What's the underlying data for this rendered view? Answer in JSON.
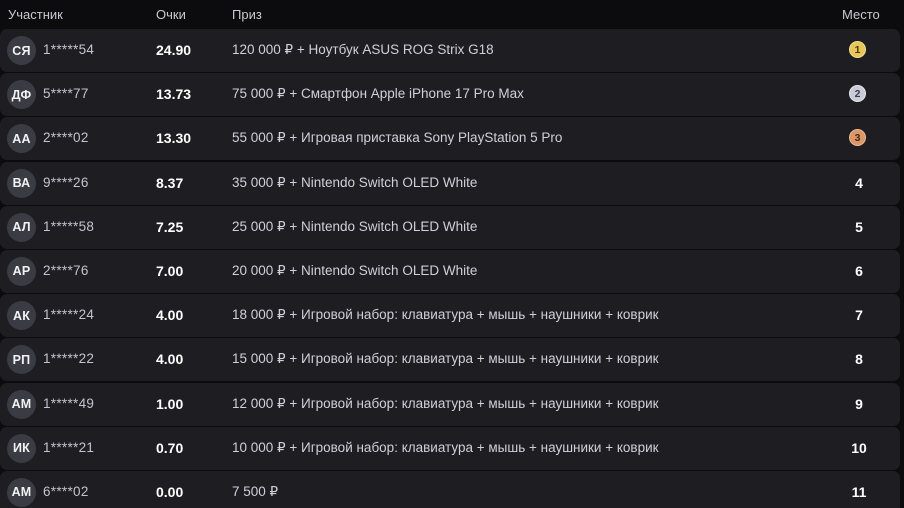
{
  "header": {
    "participant": "Участник",
    "points": "Очки",
    "prize": "Приз",
    "place": "Место"
  },
  "colors": {
    "gold": "#e8c65a",
    "silver": "#c9cbd6",
    "bronze": "#d9976a",
    "row_bg": "#1d1d22"
  },
  "rows": [
    {
      "initials": "СЯ",
      "user": "1*****54",
      "points": "24.90",
      "prize": "120 000 ₽ + Ноутбук ASUS ROG Strix G18",
      "place": "1"
    },
    {
      "initials": "ДФ",
      "user": "5****77",
      "points": "13.73",
      "prize": "75 000 ₽ + Смартфон Apple iPhone 17 Pro Max",
      "place": "2"
    },
    {
      "initials": "АА",
      "user": "2****02",
      "points": "13.30",
      "prize": "55 000 ₽ + Игровая приставка Sony PlayStation 5 Pro",
      "place": "3"
    },
    {
      "initials": "ВА",
      "user": "9****26",
      "points": "8.37",
      "prize": "35 000 ₽ + Nintendo Switch OLED White",
      "place": "4"
    },
    {
      "initials": "АЛ",
      "user": "1*****58",
      "points": "7.25",
      "prize": "25 000 ₽ + Nintendo Switch OLED White",
      "place": "5"
    },
    {
      "initials": "АР",
      "user": "2****76",
      "points": "7.00",
      "prize": "20 000 ₽ + Nintendo Switch OLED White",
      "place": "6"
    },
    {
      "initials": "АК",
      "user": "1*****24",
      "points": "4.00",
      "prize": "18 000 ₽ + Игровой набор: клавиатура + мышь + наушники + коврик",
      "place": "7"
    },
    {
      "initials": "РП",
      "user": "1*****22",
      "points": "4.00",
      "prize": "15 000 ₽ + Игровой набор: клавиатура + мышь + наушники + коврик",
      "place": "8"
    },
    {
      "initials": "АМ",
      "user": "1*****49",
      "points": "1.00",
      "prize": "12 000 ₽ + Игровой набор: клавиатура + мышь + наушники + коврик",
      "place": "9"
    },
    {
      "initials": "ИК",
      "user": "1*****21",
      "points": "0.70",
      "prize": "10 000 ₽ + Игровой набор: клавиатура + мышь + наушники + коврик",
      "place": "10"
    },
    {
      "initials": "АМ",
      "user": "6****02",
      "points": "0.00",
      "prize": "7 500 ₽",
      "place": "11"
    }
  ]
}
